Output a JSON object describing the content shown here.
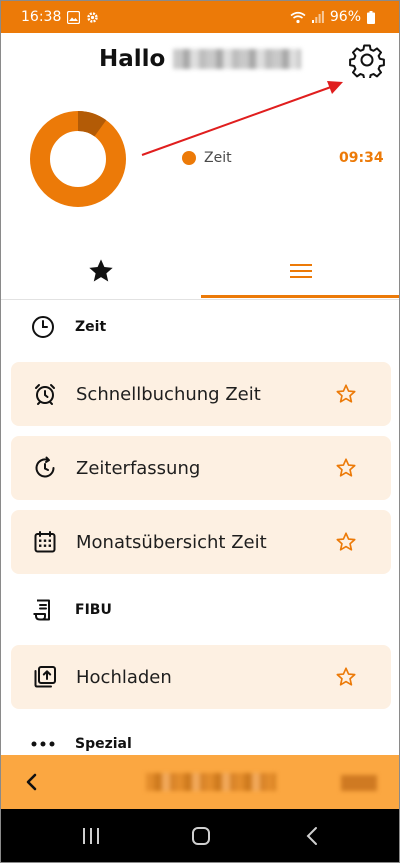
{
  "status_bar": {
    "time": "16:38",
    "battery": "96%"
  },
  "header": {
    "greeting": "Hallo"
  },
  "chart_data": {
    "type": "pie",
    "categories": [
      "Zeit"
    ],
    "values": [
      "09:34"
    ],
    "legend": [
      {
        "label": "Zeit",
        "value": "09:34",
        "color": "#ec7a08"
      }
    ],
    "filled_fraction": 0.9
  },
  "tabs": [
    {
      "name": "favorites",
      "icon": "star-icon"
    },
    {
      "name": "menu",
      "icon": "hamburger-icon",
      "active": true
    }
  ],
  "sections": [
    {
      "label": "Zeit",
      "icon": "clock-icon",
      "items": [
        {
          "label": "Schnellbuchung Zeit",
          "icon": "alarm-clock-icon"
        },
        {
          "label": "Zeiterfassung",
          "icon": "clock-refresh-icon"
        },
        {
          "label": "Monatsübersicht Zeit",
          "icon": "calendar-icon"
        }
      ]
    },
    {
      "label": "FIBU",
      "icon": "receipt-icon",
      "items": [
        {
          "label": "Hochladen",
          "icon": "upload-icon"
        }
      ]
    },
    {
      "label": "Spezial",
      "icon": "more-dots-icon",
      "items": []
    }
  ],
  "colors": {
    "accent": "#ec7a08",
    "item_bg": "#fdf0e2",
    "bottom_bar": "#fba741"
  }
}
